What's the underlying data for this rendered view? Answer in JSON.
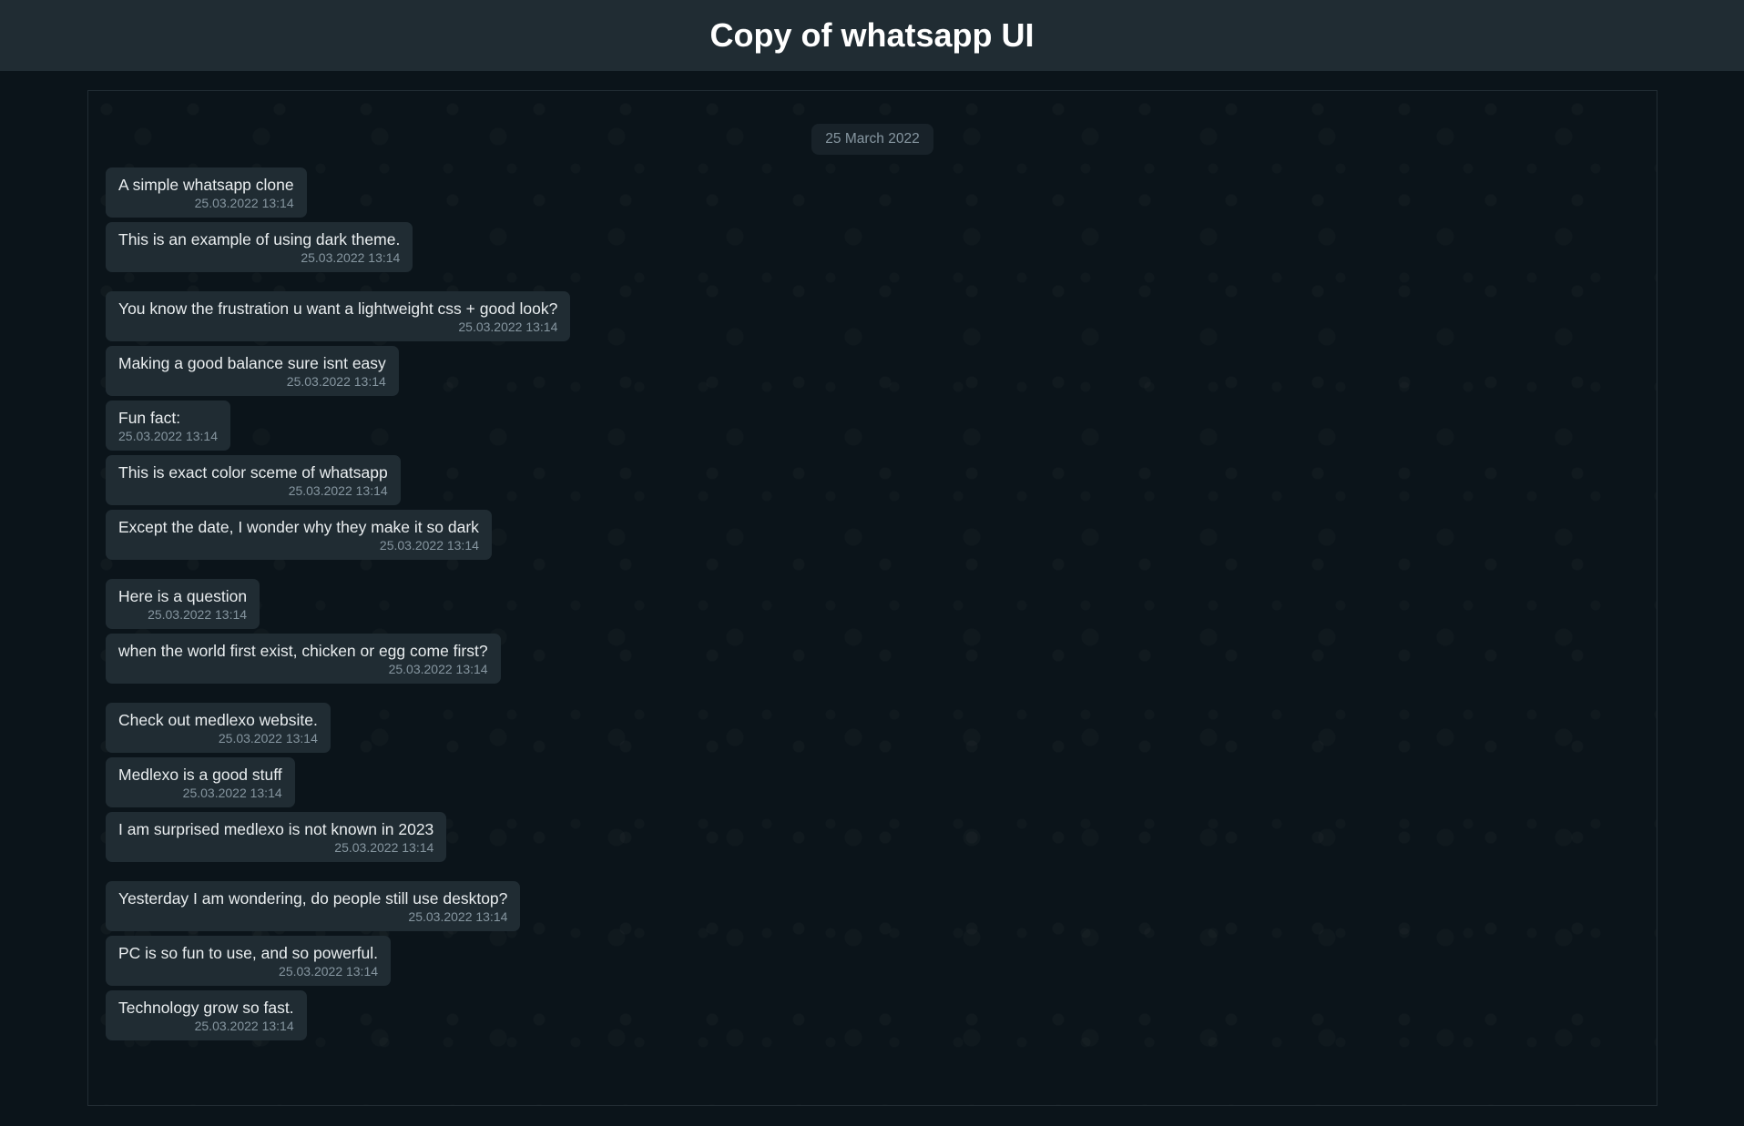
{
  "header": {
    "title": "Copy of whatsapp UI"
  },
  "chat": {
    "date_label": "25 March 2022",
    "groups": [
      {
        "messages": [
          {
            "text": "A simple whatsapp clone",
            "time": "25.03.2022 13:14"
          },
          {
            "text": "This is an example of using dark theme.",
            "time": "25.03.2022 13:14"
          }
        ]
      },
      {
        "messages": [
          {
            "text": "You know the frustration u want a lightweight css + good look?",
            "time": "25.03.2022 13:14"
          },
          {
            "text": "Making a good balance sure isnt easy",
            "time": "25.03.2022 13:14"
          },
          {
            "text": "Fun fact:",
            "time": "25.03.2022 13:14"
          },
          {
            "text": "This is exact color sceme of whatsapp",
            "time": "25.03.2022 13:14"
          },
          {
            "text": "Except the date, I wonder why they make it so dark",
            "time": "25.03.2022 13:14"
          }
        ]
      },
      {
        "messages": [
          {
            "text": "Here is a question",
            "time": "25.03.2022 13:14"
          },
          {
            "text": "when the world first exist, chicken or egg come first?",
            "time": "25.03.2022 13:14"
          }
        ]
      },
      {
        "messages": [
          {
            "text": "Check out medlexo website.",
            "time": "25.03.2022 13:14"
          },
          {
            "text": "Medlexo is a good stuff",
            "time": "25.03.2022 13:14"
          },
          {
            "text": "I am surprised medlexo is not known in 2023",
            "time": "25.03.2022 13:14"
          }
        ]
      },
      {
        "messages": [
          {
            "text": "Yesterday I am wondering, do people still use desktop?",
            "time": "25.03.2022 13:14"
          },
          {
            "text": "PC is so fun to use, and so powerful.",
            "time": "25.03.2022 13:14"
          },
          {
            "text": "Technology grow so fast.",
            "time": "25.03.2022 13:14"
          }
        ]
      }
    ]
  },
  "colors": {
    "page_bg": "#0b141a",
    "header_bg": "#202c33",
    "bubble_bg": "#202c33",
    "bubble_text": "#e9edef",
    "meta_text": "#8696a0",
    "date_pill_bg": "#182229"
  }
}
